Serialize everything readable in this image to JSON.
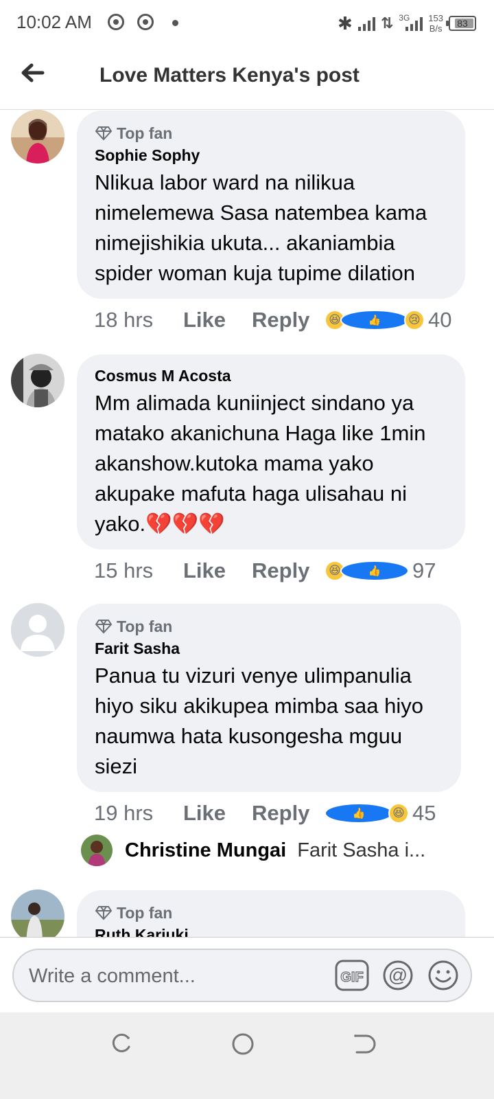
{
  "status_bar": {
    "time": "10:02 AM",
    "network": "3G",
    "speed_value": "153",
    "speed_unit": "B/s",
    "battery": "83",
    "battery_level": 0.83,
    "icons": [
      "chrome-icon",
      "chrome-icon",
      "bluetooth-icon",
      "signal-icon",
      "data-arrows-icon",
      "signal-icon",
      "battery-icon"
    ]
  },
  "header": {
    "title": "Love Matters Kenya's post",
    "back_icon": "arrow-left-icon"
  },
  "comments": [
    {
      "badge": "Top fan",
      "author": "Sophie Sophy",
      "lines": [
        "Nlikua labor ward na nilikua",
        "nimelemewa Sasa natembea kama",
        "nimejishikia ukuta... akaniambia",
        "spider woman kuja tupime dilation"
      ],
      "time": "18 hrs",
      "like_label": "Like",
      "reply_label": "Reply",
      "reactions": [
        "haha",
        "like",
        "sad"
      ],
      "reaction_count": "40"
    },
    {
      "badge": "",
      "author": "Cosmus M Acosta",
      "lines": [
        "Mm alimada kuniinject sindano ya",
        "matako akanichuna Haga like 1min",
        "akanshow.kutoka mama yako",
        "akupake mafuta haga ulisahau ni"
      ],
      "last_line_text": "yako.",
      "last_line_emoji": "💔💔💔",
      "time": "15 hrs",
      "like_label": "Like",
      "reply_label": "Reply",
      "reactions": [
        "haha",
        "like"
      ],
      "reaction_count": "97"
    },
    {
      "badge": "Top fan",
      "author": "Farit Sasha",
      "lines": [
        "Panua tu vizuri venye ulimpanulia",
        "hiyo siku akikupea mimba saa hiyo",
        "naumwa hata kusongesha mguu",
        "siezi"
      ],
      "time": "19 hrs",
      "like_label": "Like",
      "reply_label": "Reply",
      "reactions": [
        "like",
        "haha"
      ],
      "reaction_count": "45"
    },
    {
      "badge": "Top fan",
      "author": "Ruth Kariuki"
    }
  ],
  "reply_preview": {
    "name": "Christine Mungai",
    "text": "Farit Sasha i..."
  },
  "composer": {
    "placeholder": "Write a comment...",
    "tools": [
      "gif-icon",
      "mention-icon",
      "emoji-icon"
    ]
  },
  "nav": {
    "buttons": [
      "recent-apps-icon",
      "home-icon",
      "back-nav-icon"
    ]
  }
}
